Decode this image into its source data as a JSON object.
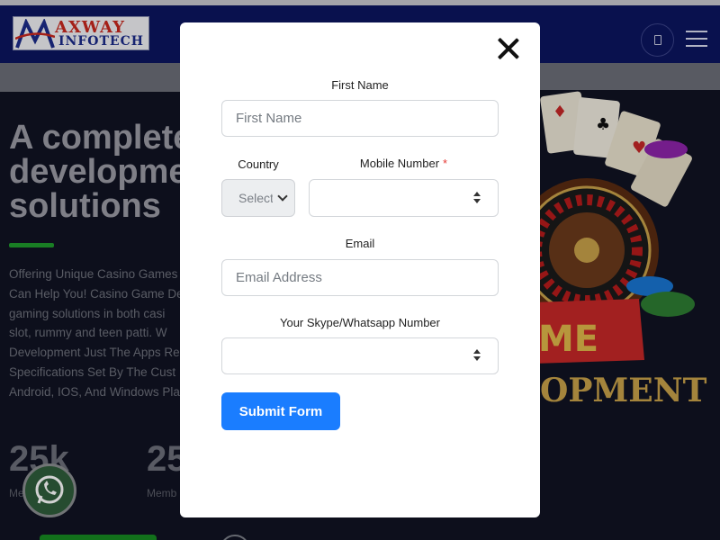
{
  "header": {
    "logo_line1": "AXWAY",
    "logo_line2": "INFOTECH"
  },
  "hero": {
    "title_lines": [
      "A complete",
      "developme",
      "solutions"
    ],
    "text_lines": [
      "Offering Unique Casino Games",
      "Can Help You! Casino Game De",
      "gaming solutions in both casi",
      "slot, rummy and teen patti. W",
      "Development Just The Apps Re",
      "Specifications Set By The Cust",
      "Android, IOS, And Windows Pla"
    ],
    "stats": [
      {
        "value": "25k",
        "label": "Me"
      },
      {
        "value": "25",
        "label": "Memb"
      }
    ],
    "banner_line1": "ME",
    "banner_line2": "OPMENT"
  },
  "modal": {
    "first_name_label": "First Name",
    "first_name_placeholder": "First Name",
    "first_name_value": "",
    "country_label": "Country",
    "country_selected": "Select",
    "mobile_label": "Mobile Number",
    "mobile_required": "*",
    "mobile_value": "",
    "email_label": "Email",
    "email_placeholder": "Email Address",
    "email_value": "",
    "skype_label": "Your Skype/Whatsapp Number",
    "skype_value": "",
    "submit_label": "Submit Form"
  },
  "colors": {
    "header_bg": "#0c1560",
    "submit_bg": "#1a7dff",
    "required": "#e53935",
    "accent_green": "#1f9a2c"
  },
  "icons": {
    "close": "close-icon",
    "whatsapp": "whatsapp-icon",
    "menu": "hamburger-menu-icon",
    "phone": "phone-icon",
    "dropdown": "chevron-down-icon",
    "spinner": "number-spinner-icon"
  }
}
